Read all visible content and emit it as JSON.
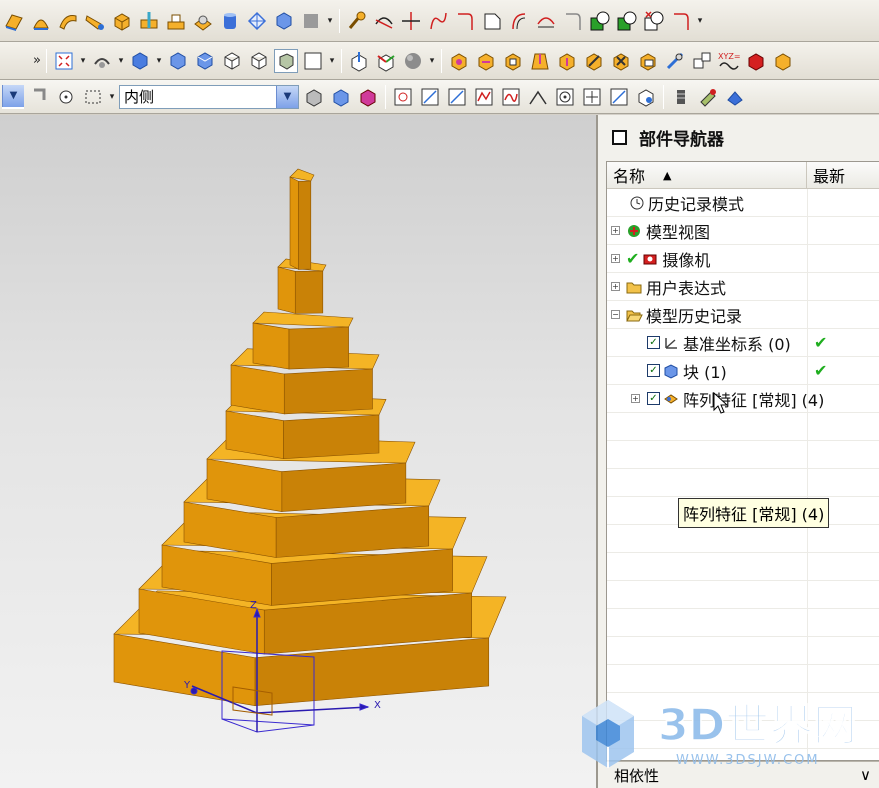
{
  "toolbar3": {
    "face_rule_value": "内侧"
  },
  "navigator": {
    "title": "部件导航器",
    "col_name": "名称",
    "col_latest": "最新",
    "items": [
      {
        "label": "历史记录模式",
        "latest": ""
      },
      {
        "label": "模型视图",
        "latest": ""
      },
      {
        "label": "摄像机",
        "latest": ""
      },
      {
        "label": "用户表达式",
        "latest": ""
      },
      {
        "label": "模型历史记录",
        "latest": ""
      },
      {
        "label": "基准坐标系 (0)",
        "latest": "✔"
      },
      {
        "label": "块 (1)",
        "latest": "✔"
      },
      {
        "label": "阵列特征 [常规] (4)",
        "latest": ""
      }
    ],
    "tooltip": "阵列特征 [常规] (4)",
    "bottom_label": "相依性",
    "bottom_chevron": "∨"
  },
  "viewport": {
    "axis_z": "Z",
    "axis_x": "X",
    "axis_y": "Y"
  },
  "watermark": {
    "title": "3D世界网",
    "url": "WWW.3DSJW.COM"
  },
  "colors": {
    "model_top": "#f4b425",
    "model_left": "#e0950b",
    "model_right": "#c98207",
    "accent_blue": "#3b6fd8"
  }
}
